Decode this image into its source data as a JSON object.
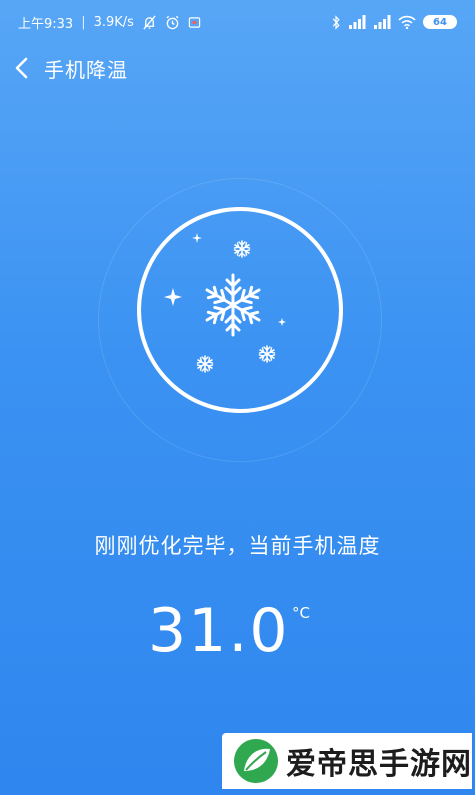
{
  "status_bar": {
    "time": "上午9:33",
    "network_speed": "3.9K/s",
    "battery": "64"
  },
  "nav": {
    "title": "手机降温"
  },
  "main": {
    "message": "刚刚优化完毕，当前手机温度",
    "temperature": "31.0",
    "unit": "°C"
  },
  "watermark": {
    "text": "爱帝思手游网"
  },
  "colors": {
    "background_top": "#57a6f6",
    "background_bottom": "#2f86ee",
    "foreground": "#ffffff"
  }
}
